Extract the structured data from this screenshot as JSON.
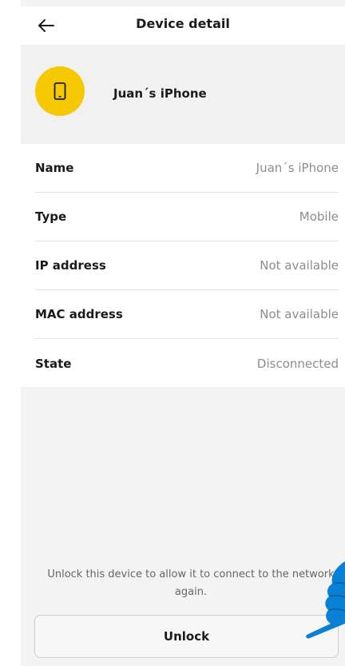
{
  "header": {
    "title": "Device detail",
    "back_icon": "arrow-left-icon"
  },
  "device": {
    "name": "Juan´s iPhone",
    "icon": "smartphone-icon",
    "avatar_color": "#F6C800"
  },
  "details": [
    {
      "label": "Name",
      "value": "Juan´s iPhone"
    },
    {
      "label": "Type",
      "value": "Mobile"
    },
    {
      "label": "IP address",
      "value": "Not available"
    },
    {
      "label": "MAC address",
      "value": "Not available"
    },
    {
      "label": "State",
      "value": "Disconnected"
    }
  ],
  "footer": {
    "info": "Unlock this device to allow it to connect to the network again.",
    "unlock_label": "Unlock"
  },
  "colors": {
    "accent": "#F6C800",
    "pointer": "#0A7FD6"
  }
}
